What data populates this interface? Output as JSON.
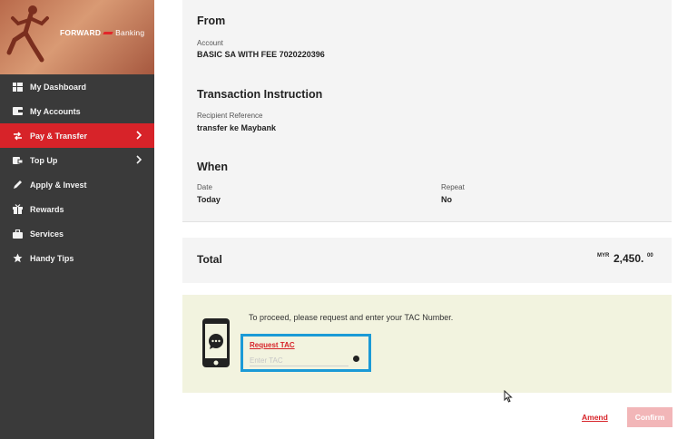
{
  "brand": {
    "name": "FORWARD",
    "suffix": "Banking"
  },
  "sidebar": {
    "items": [
      {
        "label": "My Dashboard",
        "icon": "dashboard-icon"
      },
      {
        "label": "My Accounts",
        "icon": "wallet-icon"
      },
      {
        "label": "Pay & Transfer",
        "icon": "transfer-icon",
        "active": true,
        "chevron": true
      },
      {
        "label": "Top Up",
        "icon": "topup-icon",
        "chevron": true
      },
      {
        "label": "Apply & Invest",
        "icon": "pen-icon"
      },
      {
        "label": "Rewards",
        "icon": "gift-icon"
      },
      {
        "label": "Services",
        "icon": "briefcase-icon"
      },
      {
        "label": "Handy Tips",
        "icon": "star-icon"
      }
    ]
  },
  "details": {
    "from": {
      "heading": "From",
      "account_label": "Account",
      "account_value": "BASIC SA WITH FEE 7020220396"
    },
    "instruction": {
      "heading": "Transaction Instruction",
      "ref_label": "Recipient Reference",
      "ref_value": "transfer ke Maybank"
    },
    "when": {
      "heading": "When",
      "date_label": "Date",
      "date_value": "Today",
      "repeat_label": "Repeat",
      "repeat_value": "No"
    }
  },
  "total": {
    "label": "Total",
    "currency": "MYR",
    "amount": "2,450.",
    "decimals": "00"
  },
  "tac": {
    "instruction": "To proceed, please request and enter your TAC Number.",
    "request_label": "Request TAC",
    "input_placeholder": "Enter TAC",
    "input_value": ""
  },
  "actions": {
    "amend_label": "Amend",
    "confirm_label": "Confirm"
  },
  "colors": {
    "accent": "#d72329",
    "sidebar": "#3a3a3a",
    "highlight": "#1b9ad6",
    "tac_bg": "#f2f3df"
  }
}
